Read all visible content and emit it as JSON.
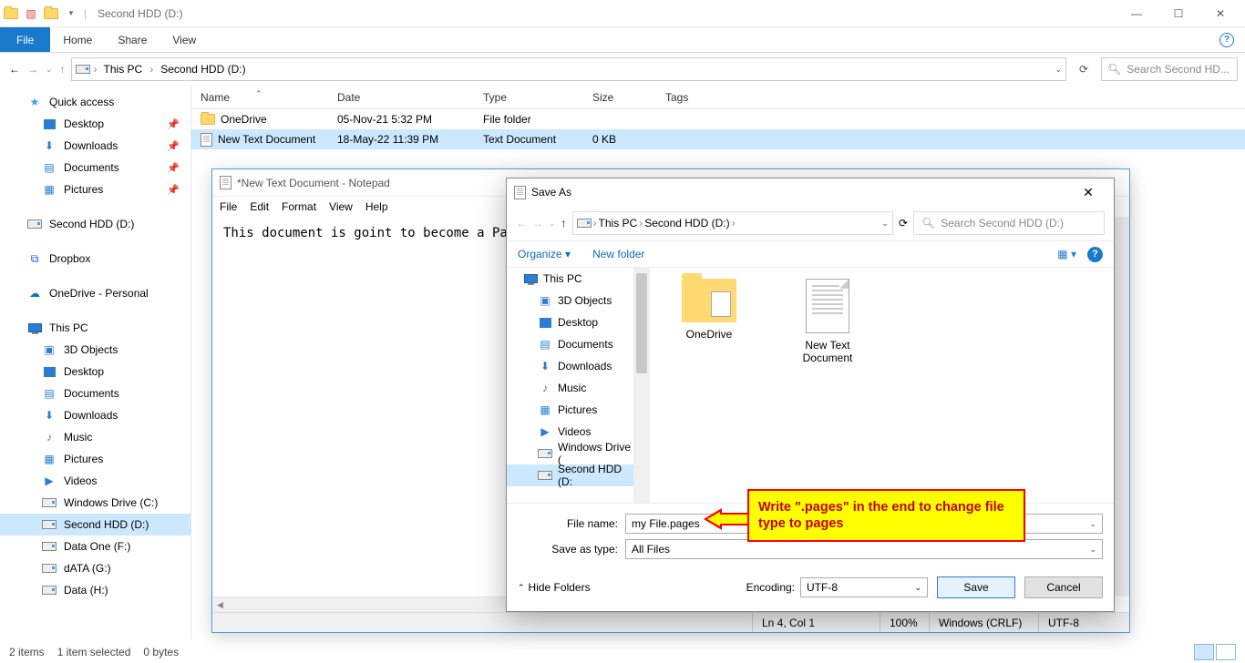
{
  "window": {
    "title": "Second HDD (D:)",
    "ribbon": {
      "file": "File",
      "home": "Home",
      "share": "Share",
      "view": "View"
    }
  },
  "address": {
    "crumbs": [
      "This PC",
      "Second HDD (D:)"
    ],
    "search_placeholder": "Search Second HD..."
  },
  "nav": {
    "quick": "Quick access",
    "items_pinned": [
      "Desktop",
      "Downloads",
      "Documents",
      "Pictures"
    ],
    "secondhdd": "Second HDD (D:)",
    "dropbox": "Dropbox",
    "onedrive": "OneDrive - Personal",
    "thispc": "This PC",
    "pc_items": [
      "3D Objects",
      "Desktop",
      "Documents",
      "Downloads",
      "Music",
      "Pictures",
      "Videos",
      "Windows Drive (C:)",
      "Second HDD (D:)",
      "Data One (F:)",
      "dATA (G:)",
      "Data (H:)"
    ]
  },
  "columns": {
    "name": "Name",
    "date": "Date",
    "type": "Type",
    "size": "Size",
    "tags": "Tags"
  },
  "rows": [
    {
      "name": "OneDrive",
      "date": "05-Nov-21 5:32 PM",
      "type": "File folder",
      "size": ""
    },
    {
      "name": "New Text Document",
      "date": "18-May-22 11:39 PM",
      "type": "Text Document",
      "size": "0 KB"
    }
  ],
  "status": {
    "items": "2 items",
    "selected": "1 item selected",
    "bytes": "0 bytes"
  },
  "notepad": {
    "title": "*New Text Document - Notepad",
    "menu": [
      "File",
      "Edit",
      "Format",
      "View",
      "Help"
    ],
    "text": "This document is goint to become a Pages",
    "status": {
      "pos": "Ln 4, Col 1",
      "zoom": "100%",
      "eol": "Windows (CRLF)",
      "enc": "UTF-8"
    }
  },
  "saveas": {
    "title": "Save As",
    "crumbs": [
      "This PC",
      "Second HDD (D:)"
    ],
    "search_placeholder": "Search Second HDD (D:)",
    "organize": "Organize",
    "newfolder": "New folder",
    "tree": {
      "thispc": "This PC",
      "items": [
        "3D Objects",
        "Desktop",
        "Documents",
        "Downloads",
        "Music",
        "Pictures",
        "Videos",
        "Windows Drive (",
        "Second HDD (D:"
      ]
    },
    "icons": [
      {
        "label": "OneDrive"
      },
      {
        "label": "New Text Document"
      }
    ],
    "filename_label": "File name:",
    "filename": "my File.pages",
    "savetype_label": "Save as type:",
    "savetype": "All Files",
    "hide": "Hide Folders",
    "encoding_label": "Encoding:",
    "encoding": "UTF-8",
    "save": "Save",
    "cancel": "Cancel"
  },
  "callout": "Write \".pages\" in the end to change file type to pages"
}
